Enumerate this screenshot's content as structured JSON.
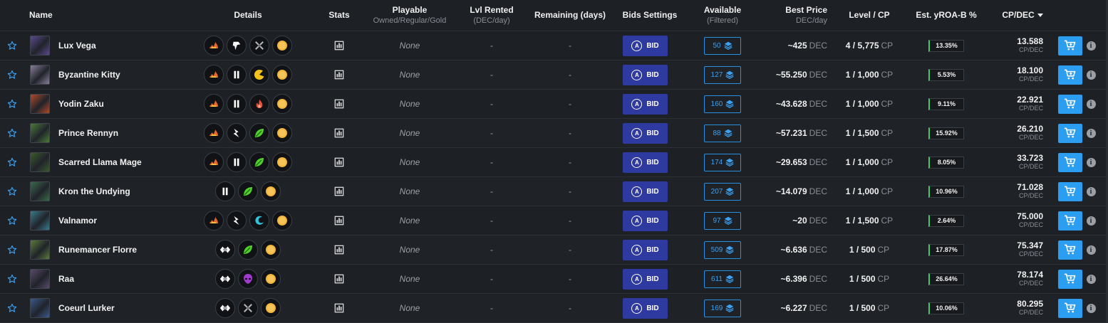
{
  "header": {
    "name": "Name",
    "details": "Details",
    "stats": "Stats",
    "playable": "Playable",
    "playable_sub": "Owned/Regular/Gold",
    "lvl_rented": "Lvl Rented",
    "lvl_rented_sub": "(DEC/day)",
    "remaining": "Remaining (days)",
    "bids": "Bids Settings",
    "available": "Available",
    "available_sub": "(Filtered)",
    "best_price": "Best Price",
    "best_price_sub": "DEC/day",
    "level_cp": "Level / CP",
    "yroa": "Est. yROA-B %",
    "cpdec": "CP/DEC"
  },
  "labels": {
    "bid": "BID",
    "price_unit": "DEC",
    "cp_unit": "CP",
    "cpdec_unit": "CP/DEC",
    "info": "i"
  },
  "colors": {
    "background": "#1d2025",
    "bid_button": "#2f3aa1",
    "available_border": "#2b8fe0",
    "cart_button": "#2b9ef2",
    "yroa_accent": "#3ec96a",
    "star": "#3ba1f2"
  },
  "rows": [
    {
      "name": "Lux Vega",
      "avatar_color": "#5a4a8c",
      "details": [
        "fire-element-icon",
        "speed-arrow-icon",
        "crossed-swords-icon",
        "gold-foil-icon"
      ],
      "playable": "None",
      "lvl_rented": "-",
      "remaining": "-",
      "available": "50",
      "price": "~425",
      "level": "4 / 5,775",
      "yroa": "13.35%",
      "cpdec": "13.588"
    },
    {
      "name": "Byzantine Kitty",
      "avatar_color": "#8a7f9a",
      "details": [
        "fire-element-icon",
        "pause-bars-icon",
        "pacman-icon",
        "gold-foil-icon"
      ],
      "playable": "None",
      "lvl_rented": "-",
      "remaining": "-",
      "available": "127",
      "price": "~55.250",
      "level": "1 / 1,000",
      "yroa": "5.53%",
      "cpdec": "18.100"
    },
    {
      "name": "Yodin Zaku",
      "avatar_color": "#b04a2a",
      "details": [
        "fire-element-icon",
        "pause-bars-icon",
        "fire-hand-icon",
        "gold-foil-icon"
      ],
      "playable": "None",
      "lvl_rented": "-",
      "remaining": "-",
      "available": "160",
      "price": "~43.628",
      "level": "1 / 1,000",
      "yroa": "9.11%",
      "cpdec": "22.921"
    },
    {
      "name": "Prince Rennyn",
      "avatar_color": "#4a7a3a",
      "details": [
        "fire-element-icon",
        "lightning-bolt-icon",
        "leaf-icon",
        "gold-foil-icon"
      ],
      "playable": "None",
      "lvl_rented": "-",
      "remaining": "-",
      "available": "88",
      "price": "~57.231",
      "level": "1 / 1,500",
      "yroa": "15.92%",
      "cpdec": "26.210"
    },
    {
      "name": "Scarred Llama Mage",
      "avatar_color": "#3a5a2a",
      "details": [
        "fire-element-icon",
        "pause-bars-icon",
        "leaf-icon",
        "gold-foil-icon"
      ],
      "playable": "None",
      "lvl_rented": "-",
      "remaining": "-",
      "available": "174",
      "price": "~29.653",
      "level": "1 / 1,000",
      "yroa": "8.05%",
      "cpdec": "33.723"
    },
    {
      "name": "Kron the Undying",
      "avatar_color": "#3a6a4a",
      "details": [
        "pause-bars-icon",
        "leaf-icon",
        "gold-foil-icon"
      ],
      "playable": "None",
      "lvl_rented": "-",
      "remaining": "-",
      "available": "207",
      "price": "~14.079",
      "level": "1 / 1,000",
      "yroa": "10.96%",
      "cpdec": "71.028"
    },
    {
      "name": "Valnamor",
      "avatar_color": "#3a7a8a",
      "details": [
        "fire-element-icon",
        "lightning-bolt-icon",
        "water-wave-icon",
        "gold-foil-icon"
      ],
      "playable": "None",
      "lvl_rented": "-",
      "remaining": "-",
      "available": "97",
      "price": "~20",
      "level": "1 / 1,500",
      "yroa": "2.64%",
      "cpdec": "75.000"
    },
    {
      "name": "Runemancer Florre",
      "avatar_color": "#5a7a3a",
      "details": [
        "diamond-chevrons-icon",
        "leaf-icon",
        "gold-foil-icon"
      ],
      "playable": "None",
      "lvl_rented": "-",
      "remaining": "-",
      "available": "509",
      "price": "~6.636",
      "level": "1 / 500",
      "yroa": "17.87%",
      "cpdec": "75.347"
    },
    {
      "name": "Raa",
      "avatar_color": "#5a4a6a",
      "details": [
        "diamond-chevrons-icon",
        "death-skull-icon",
        "gold-foil-icon"
      ],
      "playable": "None",
      "lvl_rented": "-",
      "remaining": "-",
      "available": "611",
      "price": "~6.396",
      "level": "1 / 500",
      "yroa": "26.64%",
      "cpdec": "78.174"
    },
    {
      "name": "Coeurl Lurker",
      "avatar_color": "#3a5a8a",
      "details": [
        "diamond-chevrons-icon",
        "crossed-swords-icon",
        "gold-foil-icon"
      ],
      "playable": "None",
      "lvl_rented": "-",
      "remaining": "-",
      "available": "169",
      "price": "~6.227",
      "level": "1 / 500",
      "yroa": "10.06%",
      "cpdec": "80.295"
    }
  ]
}
